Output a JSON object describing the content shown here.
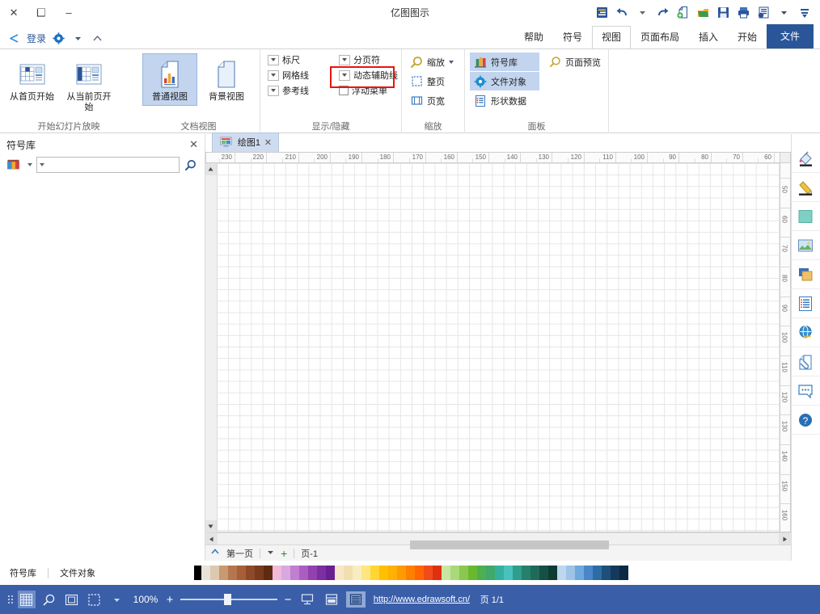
{
  "app": {
    "title": "亿图图示",
    "login_label": "登录"
  },
  "window_controls": {
    "minimize": "–",
    "maximize": "❑",
    "close": "✕"
  },
  "quick_access": [
    {
      "name": "menu-icon",
      "label": "菜单"
    },
    {
      "name": "redo-icon",
      "label": "恢复"
    },
    {
      "name": "undo-icon",
      "label": "撤销"
    },
    {
      "name": "new-icon",
      "label": "新建"
    },
    {
      "name": "open-icon",
      "label": "打开"
    },
    {
      "name": "save-icon",
      "label": "保存"
    },
    {
      "name": "print-icon",
      "label": "打印"
    },
    {
      "name": "export-icon",
      "label": "导出"
    },
    {
      "name": "customize-qat-icon",
      "label": "自定义快速访问工具栏"
    }
  ],
  "tabs": [
    {
      "label": "文件",
      "type": "file",
      "active": false
    },
    {
      "label": "开始",
      "active": false
    },
    {
      "label": "插入",
      "active": false
    },
    {
      "label": "页面布局",
      "active": false
    },
    {
      "label": "视图",
      "active": true,
      "highlighted": true
    },
    {
      "label": "符号",
      "active": false
    },
    {
      "label": "帮助",
      "active": false
    }
  ],
  "ribbon": {
    "groups": [
      {
        "title": "开始幻灯片放映",
        "name": "group-slideshow",
        "big_buttons": [
          {
            "label": "从首页开始",
            "icon": "slideshow-first-page-icon",
            "selected": false
          },
          {
            "label": "从当前页开始",
            "icon": "slideshow-current-page-icon",
            "selected": false
          }
        ]
      },
      {
        "title": "文档视图",
        "name": "group-document-view",
        "big_buttons": [
          {
            "label": "普通视图",
            "icon": "normal-view-icon",
            "selected": true
          },
          {
            "label": "背景视图",
            "icon": "background-view-icon",
            "selected": false
          }
        ]
      },
      {
        "title": "显示/隐藏",
        "name": "group-show-hide",
        "rows": [
          {
            "label": "标尺",
            "control": "dropdown",
            "checked": false
          },
          {
            "label": "网格线",
            "control": "dropdown",
            "checked": false,
            "highlighted": true
          },
          {
            "label": "参考线",
            "control": "dropdown",
            "checked": false
          },
          {
            "label": "分页符",
            "control": "dropdown",
            "checked": false
          },
          {
            "label": "动态辅助线",
            "control": "dropdown",
            "checked": false
          },
          {
            "label": "浮动菜单",
            "control": "checkbox",
            "checked": false
          }
        ]
      },
      {
        "title": "缩放",
        "name": "group-zoom",
        "rows": [
          {
            "label": "缩放",
            "icon": "magnifier-icon",
            "control": "dropdown"
          },
          {
            "label": "整页",
            "icon": "fit-page-icon"
          },
          {
            "label": "页宽",
            "icon": "fit-width-icon"
          }
        ]
      },
      {
        "title": "面板",
        "name": "group-panel",
        "rows": [
          {
            "label": "符号库",
            "icon": "symbol-library-icon",
            "selected": true
          },
          {
            "label": "文件对象",
            "icon": "file-object-icon",
            "selected": true
          },
          {
            "label": "形状数据",
            "icon": "shape-data-icon",
            "selected": false
          },
          {
            "label": "页面预览",
            "icon": "page-preview-icon",
            "selected": false
          }
        ]
      }
    ]
  },
  "tool_rail": [
    {
      "name": "fill-tool-icon",
      "label": "填充"
    },
    {
      "name": "line-tool-icon",
      "label": "线条"
    },
    {
      "name": "shape-tool-icon",
      "label": "形状"
    },
    {
      "name": "image-tool-icon",
      "label": "图片"
    },
    {
      "name": "layers-tool-icon",
      "label": "图层"
    },
    {
      "name": "form-tool-icon",
      "label": "表单"
    },
    {
      "name": "hyperlink-tool-icon",
      "label": "超链接"
    },
    {
      "name": "attachment-tool-icon",
      "label": "附件"
    },
    {
      "name": "comment-tool-icon",
      "label": "批注"
    },
    {
      "name": "help-tool-icon",
      "label": "帮助"
    }
  ],
  "document": {
    "tab_label": "绘图1",
    "tab_close": "✕"
  },
  "library_panel": {
    "title": "符号库",
    "close": "✕",
    "search_value": "",
    "search_placeholder": ""
  },
  "rulers": {
    "horizontal": [
      60,
      70,
      80,
      90,
      100,
      110,
      120,
      130,
      140,
      150,
      160,
      170,
      180,
      190,
      200,
      210,
      220,
      230
    ],
    "vertical": [
      50,
      60,
      70,
      80,
      90,
      100,
      110,
      120,
      130,
      140,
      150,
      160
    ]
  },
  "page_nav": {
    "prev_label": "第一页",
    "next_label": "页-1",
    "add_label": "+",
    "current": "页-1"
  },
  "status_bar": {
    "zoom_label": "100%",
    "zoom_minus": "−",
    "zoom_plus": "+",
    "page_indicator": "页 1/1",
    "url": "http://www.edrawsoft.cn/",
    "panel_buttons": [
      {
        "name": "symbol-library-status-button",
        "label": "符号库"
      },
      {
        "name": "file-object-status-button",
        "label": "文件对象"
      }
    ],
    "view_buttons": [
      {
        "name": "presentation-view-icon",
        "active": false
      },
      {
        "name": "split-view-icon",
        "active": false
      },
      {
        "name": "full-view-icon",
        "active": true
      }
    ],
    "left_icons": [
      {
        "name": "grid-toggle-icon",
        "active": true
      },
      {
        "name": "zoom-selection-icon",
        "active": false
      },
      {
        "name": "fit-page-status-icon",
        "active": false
      },
      {
        "name": "select-mode-icon",
        "active": false
      }
    ]
  },
  "colors": {
    "accent": "#2a5699",
    "status_bar": "#3a5ea8",
    "highlight": "#e8150f",
    "selected_ribbon": "#c2d4ee",
    "palette": [
      "#ffffff",
      "#f2f2f2",
      "#e6e6e6",
      "#d9d9d9",
      "#cccccc",
      "#bfbfbf",
      "#a6a6a6",
      "#808080",
      "#595959",
      "#404040",
      "#262626",
      "#0d0d0d",
      "#000000",
      "#e8e2d8",
      "#dcc9b0",
      "#c89a72",
      "#b5764f",
      "#a75f38",
      "#8c4a28",
      "#7a3a1e",
      "#5e2a12",
      "#f2b9d8",
      "#d9a8e0",
      "#c07fd0",
      "#aa5fc0",
      "#9340b0",
      "#7b2fa0",
      "#6a2090",
      "#f7e7c8",
      "#f2dfb0",
      "#f7eec0",
      "#ffe680",
      "#ffd633",
      "#ffc000",
      "#ffb000",
      "#ff9a00",
      "#ff8000",
      "#ff6600",
      "#f24b1a",
      "#e03010",
      "#c8e6a0",
      "#a8d97a",
      "#8cc84f",
      "#6bb82f",
      "#4caf50",
      "#3fa86b",
      "#35b0a0",
      "#48c2bd",
      "#2f9e8a",
      "#27806e",
      "#1e6b5a",
      "#155045",
      "#0e3b32",
      "#bdd7ee",
      "#9dc3e6",
      "#6fa8dc",
      "#4a86c8",
      "#2e6da4",
      "#1f4e79",
      "#15395b",
      "#0d2842"
    ]
  }
}
